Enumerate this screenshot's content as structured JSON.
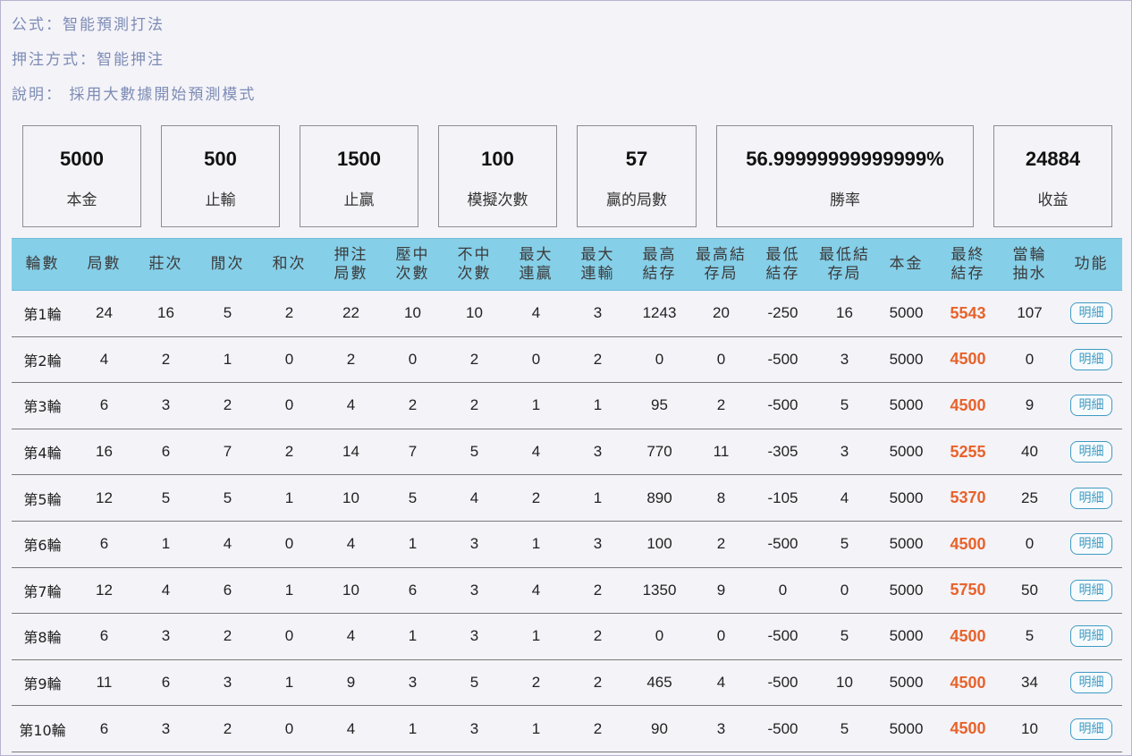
{
  "info": {
    "formula": "公式：智能預測打法",
    "bet_method": "押注方式：智能押注",
    "description": "說明： 採用大數據開始預測模式"
  },
  "stats": [
    {
      "value": "5000",
      "label": "本金"
    },
    {
      "value": "500",
      "label": "止輸"
    },
    {
      "value": "1500",
      "label": "止贏"
    },
    {
      "value": "100",
      "label": "模擬次數"
    },
    {
      "value": "57",
      "label": "贏的局數"
    },
    {
      "value": "56.99999999999999%",
      "label": "勝率"
    },
    {
      "value": "24884",
      "label": "收益"
    }
  ],
  "table": {
    "headers": [
      [
        "輪數"
      ],
      [
        "局數"
      ],
      [
        "莊次"
      ],
      [
        "閒次"
      ],
      [
        "和次"
      ],
      [
        "押注",
        "局數"
      ],
      [
        "壓中",
        "次數"
      ],
      [
        "不中",
        "次數"
      ],
      [
        "最大",
        "連贏"
      ],
      [
        "最大",
        "連輸"
      ],
      [
        "最高",
        "結存"
      ],
      [
        "最高結",
        "存局"
      ],
      [
        "最低",
        "結存"
      ],
      [
        "最低結",
        "存局"
      ],
      [
        "本金"
      ],
      [
        "最終",
        "結存"
      ],
      [
        "當輪",
        "抽水"
      ],
      [
        "功能"
      ]
    ],
    "detail_label": "明細",
    "final_color": "#e8622a",
    "rows": [
      [
        "第1輪",
        "24",
        "16",
        "5",
        "2",
        "22",
        "10",
        "10",
        "4",
        "3",
        "1243",
        "20",
        "-250",
        "16",
        "5000",
        "5543",
        "107"
      ],
      [
        "第2輪",
        "4",
        "2",
        "1",
        "0",
        "2",
        "0",
        "2",
        "0",
        "2",
        "0",
        "0",
        "-500",
        "3",
        "5000",
        "4500",
        "0"
      ],
      [
        "第3輪",
        "6",
        "3",
        "2",
        "0",
        "4",
        "2",
        "2",
        "1",
        "1",
        "95",
        "2",
        "-500",
        "5",
        "5000",
        "4500",
        "9"
      ],
      [
        "第4輪",
        "16",
        "6",
        "7",
        "2",
        "14",
        "7",
        "5",
        "4",
        "3",
        "770",
        "11",
        "-305",
        "3",
        "5000",
        "5255",
        "40"
      ],
      [
        "第5輪",
        "12",
        "5",
        "5",
        "1",
        "10",
        "5",
        "4",
        "2",
        "1",
        "890",
        "8",
        "-105",
        "4",
        "5000",
        "5370",
        "25"
      ],
      [
        "第6輪",
        "6",
        "1",
        "4",
        "0",
        "4",
        "1",
        "3",
        "1",
        "3",
        "100",
        "2",
        "-500",
        "5",
        "5000",
        "4500",
        "0"
      ],
      [
        "第7輪",
        "12",
        "4",
        "6",
        "1",
        "10",
        "6",
        "3",
        "4",
        "2",
        "1350",
        "9",
        "0",
        "0",
        "5000",
        "5750",
        "50"
      ],
      [
        "第8輪",
        "6",
        "3",
        "2",
        "0",
        "4",
        "1",
        "3",
        "1",
        "2",
        "0",
        "0",
        "-500",
        "5",
        "5000",
        "4500",
        "5"
      ],
      [
        "第9輪",
        "11",
        "6",
        "3",
        "1",
        "9",
        "3",
        "5",
        "2",
        "2",
        "465",
        "4",
        "-500",
        "10",
        "5000",
        "4500",
        "34"
      ],
      [
        "第10輪",
        "6",
        "3",
        "2",
        "0",
        "4",
        "1",
        "3",
        "1",
        "2",
        "90",
        "3",
        "-500",
        "5",
        "5000",
        "4500",
        "10"
      ]
    ]
  }
}
